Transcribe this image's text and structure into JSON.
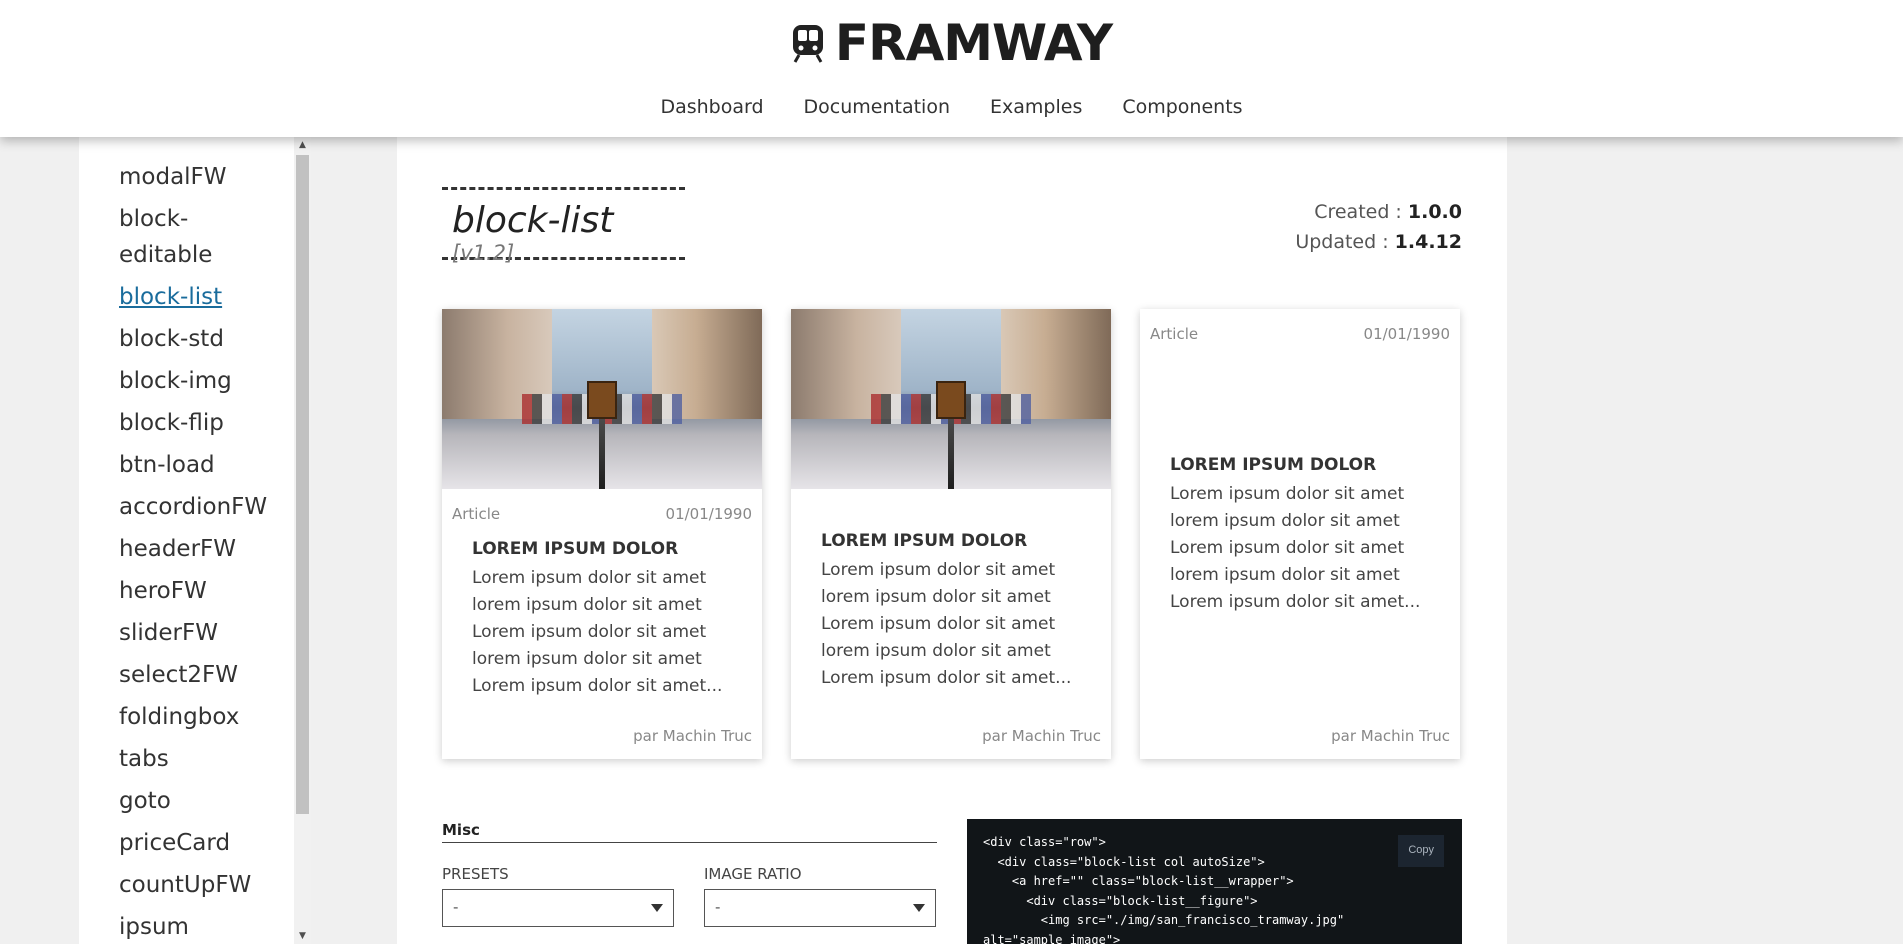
{
  "header": {
    "logo_icon": "tram-icon",
    "logo_text": "FRAMWAY",
    "nav": [
      "Dashboard",
      "Documentation",
      "Examples",
      "Components"
    ]
  },
  "sidebar": {
    "items": [
      "modalFW",
      "block-editable",
      "block-list",
      "block-std",
      "block-img",
      "block-flip",
      "btn-load",
      "accordionFW",
      "headerFW",
      "heroFW",
      "sliderFW",
      "select2FW",
      "foldingbox",
      "tabs",
      "goto",
      "priceCard",
      "countUpFW",
      "ipsum"
    ],
    "active": "block-list"
  },
  "component": {
    "name": "block-list",
    "version": "[v1.2]",
    "created_label": "Created :",
    "created_value": "1.0.0",
    "updated_label": "Updated :",
    "updated_value": "1.4.12"
  },
  "cards": [
    {
      "category": "Article",
      "date": "01/01/1990",
      "title": "LOREM IPSUM DOLOR",
      "text": "Lorem ipsum dolor sit amet\nlorem ipsum dolor sit amet\nLorem ipsum dolor sit amet\nlorem ipsum dolor sit amet\nLorem ipsum dolor sit amet...",
      "author": "par Machin Truc"
    },
    {
      "title": "LOREM IPSUM DOLOR",
      "text": "Lorem ipsum dolor sit amet\nlorem ipsum dolor sit amet\nLorem ipsum dolor sit amet\nlorem ipsum dolor sit amet\nLorem ipsum dolor sit amet...",
      "author": "par Machin Truc"
    },
    {
      "category": "Article",
      "date": "01/01/1990",
      "title": "LOREM IPSUM DOLOR",
      "text": "Lorem ipsum dolor sit amet\nlorem ipsum dolor sit amet\nLorem ipsum dolor sit amet\nlorem ipsum dolor sit amet\nLorem ipsum dolor sit amet...",
      "author": "par Machin Truc"
    }
  ],
  "misc": {
    "title": "Misc",
    "presets_label": "PRESETS",
    "presets_value": "-",
    "ratio_label": "IMAGE RATIO",
    "ratio_value": "-"
  },
  "code": {
    "copy_label": "Copy",
    "lines": [
      "<div class=\"row\">",
      "  <div class=\"block-list col autoSize\">",
      "    <a href=\"\" class=\"block-list__wrapper\">",
      "      <div class=\"block-list__figure\">",
      "        <img src=\"./img/san_francisco_tramway.jpg\"",
      "alt=\"sample image\">"
    ]
  }
}
